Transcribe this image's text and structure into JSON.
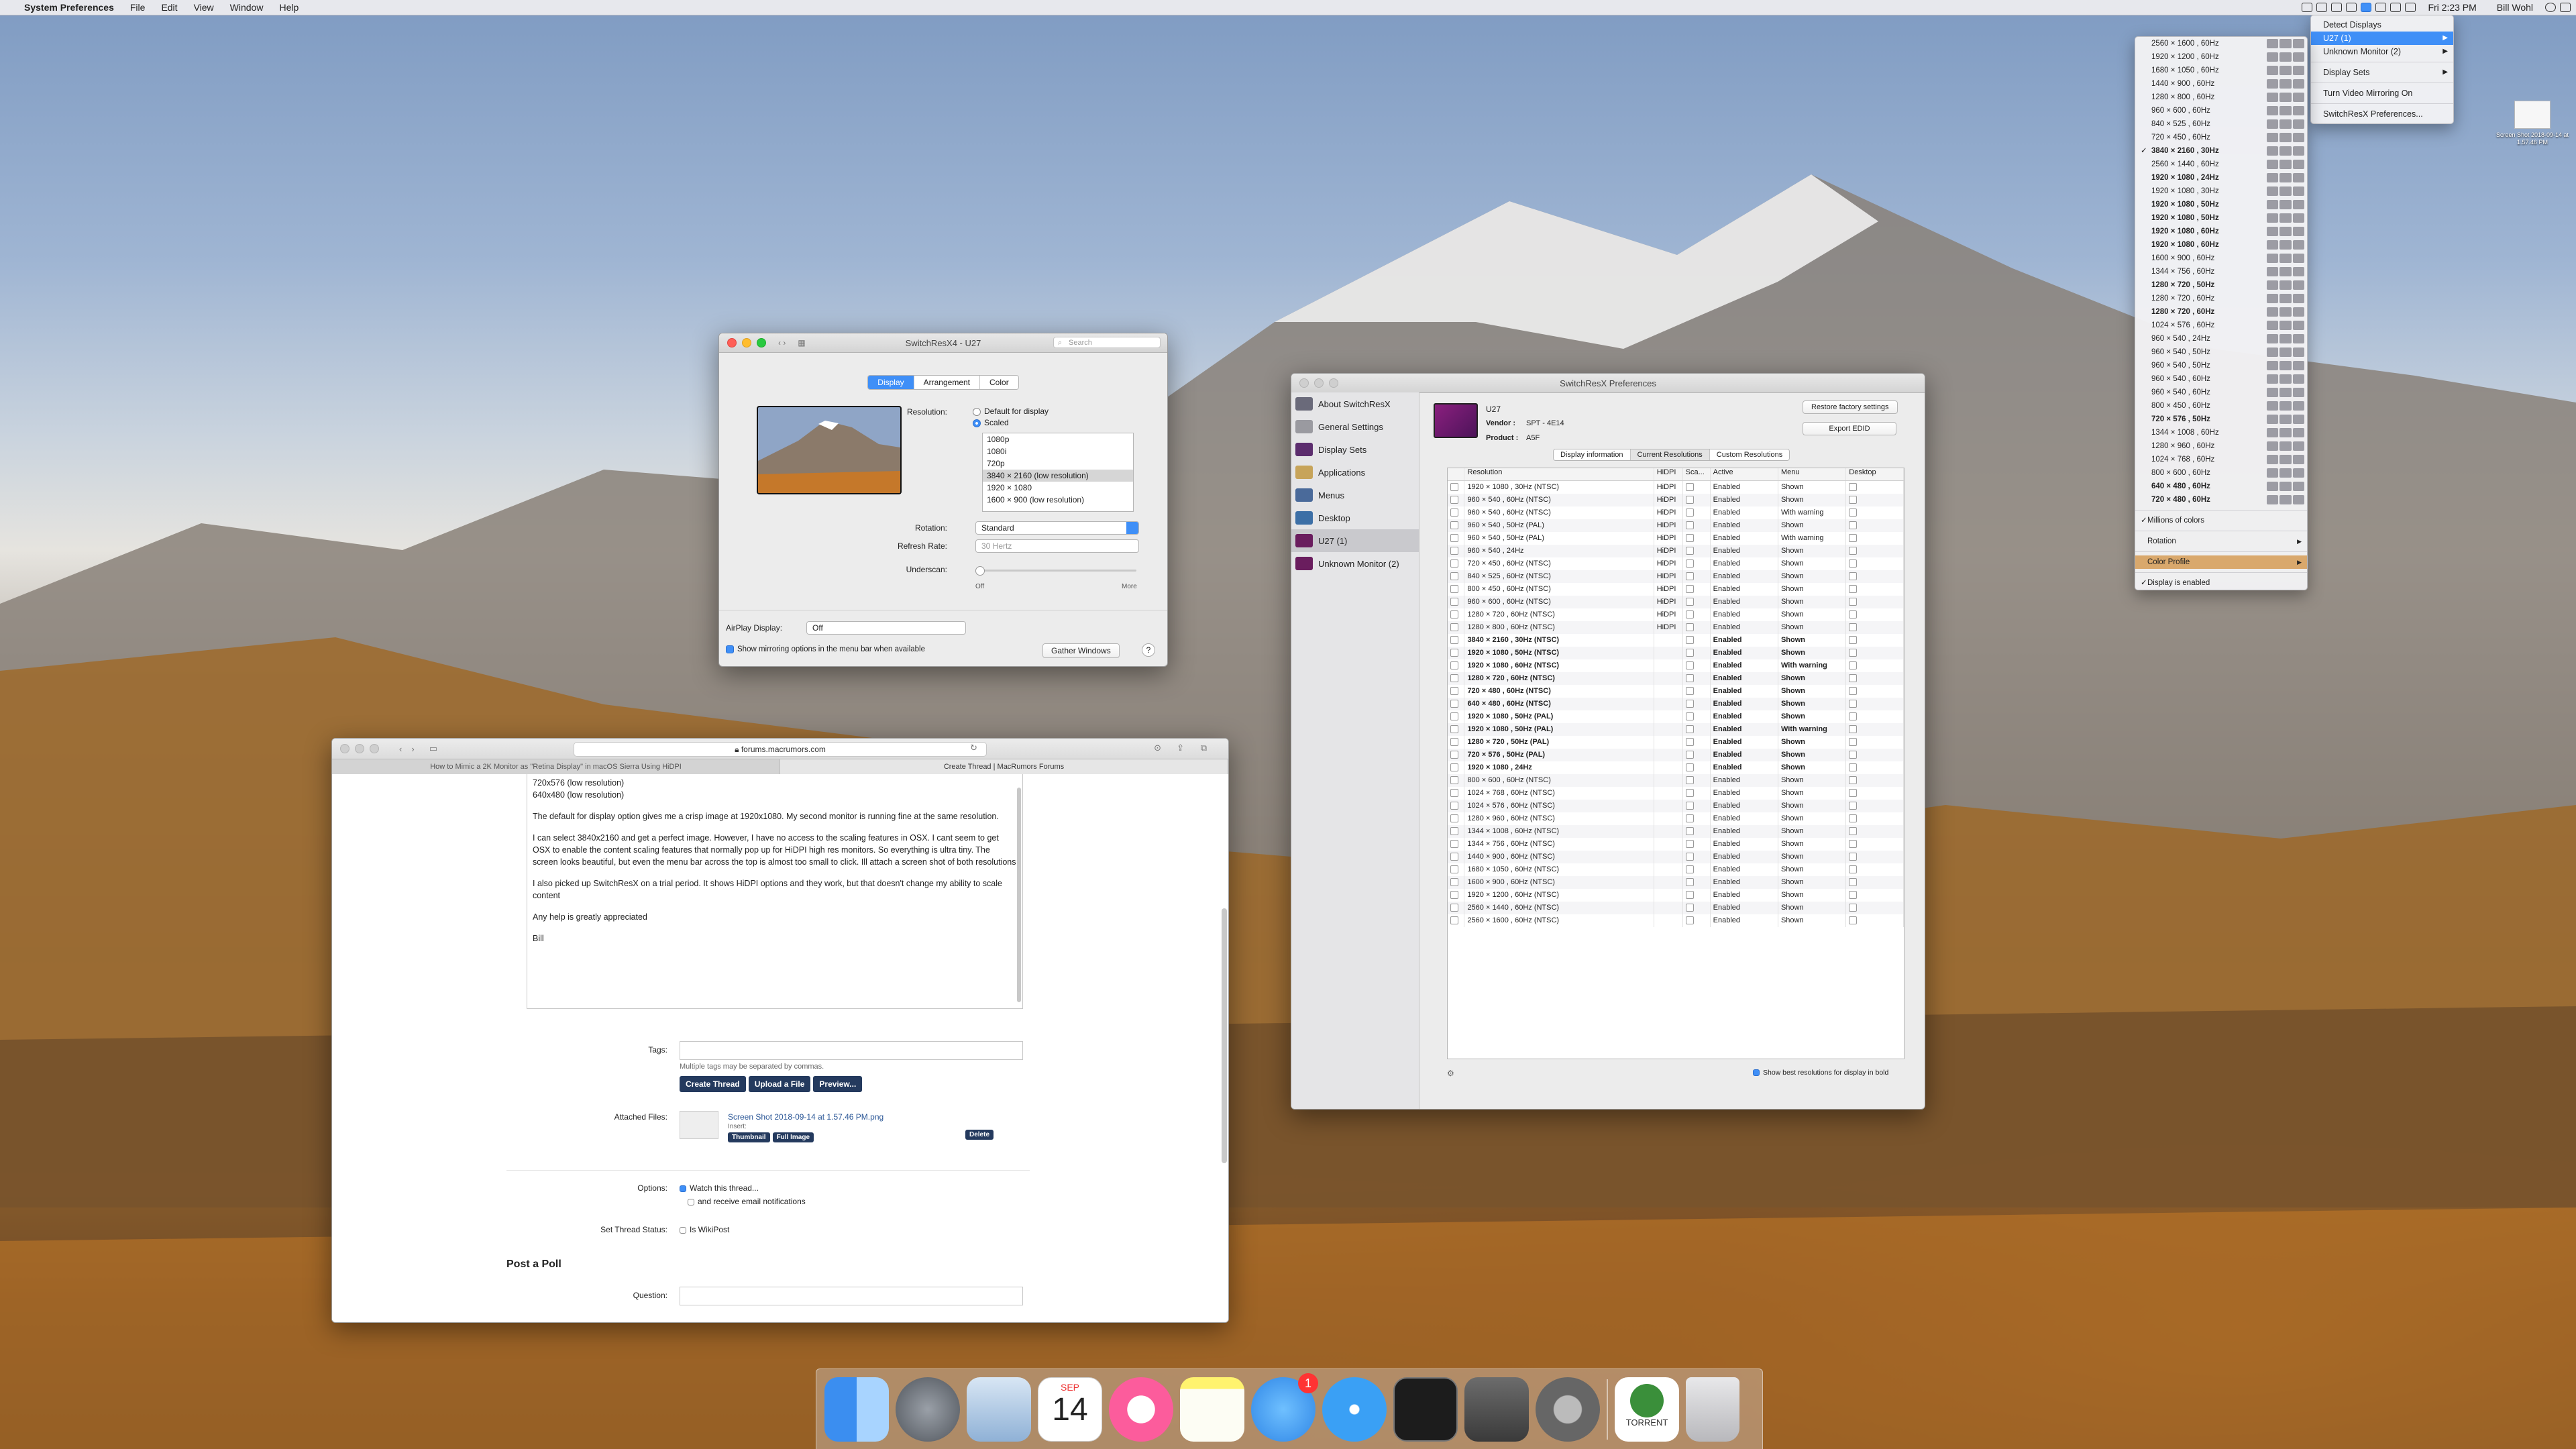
{
  "menubar": {
    "app_name": "System Preferences",
    "items": [
      "File",
      "Edit",
      "View",
      "Window",
      "Help"
    ],
    "clock": "Fri 2:23 PM",
    "user": "Bill Wohl"
  },
  "display_window": {
    "title": "SwitchResX4 - U27",
    "search_placeholder": "Search",
    "tabs": [
      "Display",
      "Arrangement",
      "Color"
    ],
    "resolution_label": "Resolution:",
    "default_option": "Default for display",
    "scaled_option": "Scaled",
    "resolutions": [
      "1080p",
      "1080i",
      "720p",
      "3840 × 2160 (low resolution)",
      "1920 × 1080",
      "1600 × 900 (low resolution)"
    ],
    "selected_resolution": "3840 × 2160 (low resolution)",
    "rotation_label": "Rotation:",
    "rotation_value": "Standard",
    "refresh_label": "Refresh Rate:",
    "refresh_value": "30 Hertz",
    "underscan_label": "Underscan:",
    "underscan_min": "Off",
    "underscan_max": "More",
    "airplay_label": "AirPlay Display:",
    "airplay_value": "Off",
    "mirroring_checkbox": "Show mirroring options in the menu bar when available",
    "gather_button": "Gather Windows",
    "help": "?"
  },
  "srx_prefs": {
    "title": "SwitchResX Preferences",
    "sidebar": [
      "About SwitchResX",
      "General Settings",
      "Display Sets",
      "Applications",
      "Menus",
      "Desktop",
      "U27 (1)",
      "Unknown Monitor (2)"
    ],
    "monitor_name": "U27",
    "vendor_label": "Vendor :",
    "vendor_value": "SPT - 4E14",
    "product_label": "Product :",
    "product_value": "A5F",
    "restore_button": "Restore factory settings",
    "export_button": "Export EDID",
    "tabs": [
      "Display information",
      "Current Resolutions",
      "Custom Resolutions"
    ],
    "columns": [
      "Resolution",
      "HiDPI",
      "Sca...",
      "Active",
      "Menu",
      "Desktop"
    ],
    "rows": [
      {
        "res": "1920 × 1080 , 30Hz (NTSC)",
        "hidpi": "HiDPI",
        "active": "Enabled",
        "menu": "Shown",
        "bold": false
      },
      {
        "res": "960 × 540 , 60Hz (NTSC)",
        "hidpi": "HiDPI",
        "active": "Enabled",
        "menu": "Shown",
        "bold": false
      },
      {
        "res": "960 × 540 , 60Hz (NTSC)",
        "hidpi": "HiDPI",
        "active": "Enabled",
        "menu": "With warning",
        "bold": false
      },
      {
        "res": "960 × 540 , 50Hz (PAL)",
        "hidpi": "HiDPI",
        "active": "Enabled",
        "menu": "Shown",
        "bold": false
      },
      {
        "res": "960 × 540 , 50Hz (PAL)",
        "hidpi": "HiDPI",
        "active": "Enabled",
        "menu": "With warning",
        "bold": false
      },
      {
        "res": "960 × 540 , 24Hz",
        "hidpi": "HiDPI",
        "active": "Enabled",
        "menu": "Shown",
        "bold": false
      },
      {
        "res": "720 × 450 , 60Hz (NTSC)",
        "hidpi": "HiDPI",
        "active": "Enabled",
        "menu": "Shown",
        "bold": false
      },
      {
        "res": "840 × 525 , 60Hz (NTSC)",
        "hidpi": "HiDPI",
        "active": "Enabled",
        "menu": "Shown",
        "bold": false
      },
      {
        "res": "800 × 450 , 60Hz (NTSC)",
        "hidpi": "HiDPI",
        "active": "Enabled",
        "menu": "Shown",
        "bold": false
      },
      {
        "res": "960 × 600 , 60Hz (NTSC)",
        "hidpi": "HiDPI",
        "active": "Enabled",
        "menu": "Shown",
        "bold": false
      },
      {
        "res": "1280 × 720 , 60Hz (NTSC)",
        "hidpi": "HiDPI",
        "active": "Enabled",
        "menu": "Shown",
        "bold": false
      },
      {
        "res": "1280 × 800 , 60Hz (NTSC)",
        "hidpi": "HiDPI",
        "active": "Enabled",
        "menu": "Shown",
        "bold": false
      },
      {
        "res": "3840 × 2160 , 30Hz (NTSC)",
        "hidpi": "",
        "active": "Enabled",
        "menu": "Shown",
        "bold": true
      },
      {
        "res": "1920 × 1080 , 50Hz (NTSC)",
        "hidpi": "",
        "active": "Enabled",
        "menu": "Shown",
        "bold": true
      },
      {
        "res": "1920 × 1080 , 60Hz (NTSC)",
        "hidpi": "",
        "active": "Enabled",
        "menu": "With warning",
        "bold": true
      },
      {
        "res": "1280 × 720 , 60Hz (NTSC)",
        "hidpi": "",
        "active": "Enabled",
        "menu": "Shown",
        "bold": true
      },
      {
        "res": "720 × 480 , 60Hz (NTSC)",
        "hidpi": "",
        "active": "Enabled",
        "menu": "Shown",
        "bold": true
      },
      {
        "res": "640 × 480 , 60Hz (NTSC)",
        "hidpi": "",
        "active": "Enabled",
        "menu": "Shown",
        "bold": true
      },
      {
        "res": "1920 × 1080 , 50Hz (PAL)",
        "hidpi": "",
        "active": "Enabled",
        "menu": "Shown",
        "bold": true
      },
      {
        "res": "1920 × 1080 , 50Hz (PAL)",
        "hidpi": "",
        "active": "Enabled",
        "menu": "With warning",
        "bold": true
      },
      {
        "res": "1280 × 720 , 50Hz (PAL)",
        "hidpi": "",
        "active": "Enabled",
        "menu": "Shown",
        "bold": true
      },
      {
        "res": "720 × 576 , 50Hz (PAL)",
        "hidpi": "",
        "active": "Enabled",
        "menu": "Shown",
        "bold": true
      },
      {
        "res": "1920 × 1080 , 24Hz",
        "hidpi": "",
        "active": "Enabled",
        "menu": "Shown",
        "bold": true
      },
      {
        "res": "800 × 600 , 60Hz (NTSC)",
        "hidpi": "",
        "active": "Enabled",
        "menu": "Shown",
        "bold": false
      },
      {
        "res": "1024 × 768 , 60Hz (NTSC)",
        "hidpi": "",
        "active": "Enabled",
        "menu": "Shown",
        "bold": false
      },
      {
        "res": "1024 × 576 , 60Hz (NTSC)",
        "hidpi": "",
        "active": "Enabled",
        "menu": "Shown",
        "bold": false
      },
      {
        "res": "1280 × 960 , 60Hz (NTSC)",
        "hidpi": "",
        "active": "Enabled",
        "menu": "Shown",
        "bold": false
      },
      {
        "res": "1344 × 1008 , 60Hz (NTSC)",
        "hidpi": "",
        "active": "Enabled",
        "menu": "Shown",
        "bold": false
      },
      {
        "res": "1344 × 756 , 60Hz (NTSC)",
        "hidpi": "",
        "active": "Enabled",
        "menu": "Shown",
        "bold": false
      },
      {
        "res": "1440 × 900 , 60Hz (NTSC)",
        "hidpi": "",
        "active": "Enabled",
        "menu": "Shown",
        "bold": false
      },
      {
        "res": "1680 × 1050 , 60Hz (NTSC)",
        "hidpi": "",
        "active": "Enabled",
        "menu": "Shown",
        "bold": false
      },
      {
        "res": "1600 × 900 , 60Hz (NTSC)",
        "hidpi": "",
        "active": "Enabled",
        "menu": "Shown",
        "bold": false
      },
      {
        "res": "1920 × 1200 , 60Hz (NTSC)",
        "hidpi": "",
        "active": "Enabled",
        "menu": "Shown",
        "bold": false
      },
      {
        "res": "2560 × 1440 , 60Hz (NTSC)",
        "hidpi": "",
        "active": "Enabled",
        "menu": "Shown",
        "bold": false
      },
      {
        "res": "2560 × 1600 , 60Hz (NTSC)",
        "hidpi": "",
        "active": "Enabled",
        "menu": "Shown",
        "bold": false
      }
    ],
    "footer_checkbox": "Show best resolutions for display in bold"
  },
  "browser": {
    "url": "forums.macrumors.com",
    "tabs": [
      "How to Mimic a 2K Monitor as \"Retina Display\" in macOS Sierra Using HiDPI",
      "Create Thread | MacRumors Forums"
    ],
    "message_lines": [
      "720x576 (low resolution)",
      "640x480 (low resolution)"
    ],
    "message_paragraphs": [
      "The default for display option gives me a crisp image at 1920x1080. My second monitor is running fine at the same resolution.",
      "I can select 3840x2160 and get a perfect image. However, I have no access to the scaling features in OSX. I cant seem to get OSX to enable the content scaling features that normally pop up for HiDPI high res monitors. So everything is ultra tiny. The screen looks beautiful, but even the menu bar across the top is almost too small to click. Ill attach a screen shot of both resolutions",
      "I also picked up SwitchResX on a trial period. It shows HiDPI options and they work, but that doesn't change my ability to scale content",
      "Any help is greatly appreciated",
      "Bill"
    ],
    "tags_label": "Tags:",
    "tags_hint": "Multiple tags may be separated by commas.",
    "create_thread": "Create Thread",
    "upload_file": "Upload a File",
    "preview": "Preview...",
    "attached_label": "Attached Files:",
    "attachment_name": "Screen Shot 2018-09-14 at 1.57.46 PM.png",
    "insert_label": "Insert:",
    "thumbnail_btn": "Thumbnail",
    "fullimage_btn": "Full Image",
    "delete_btn": "Delete",
    "options_label": "Options:",
    "watch_option": "Watch this thread...",
    "email_option": "and receive email notifications",
    "status_label": "Set Thread Status:",
    "wikipost_option": "Is WikiPost",
    "poll_heading": "Post a Poll",
    "question_label": "Question:"
  },
  "display_menu": {
    "items": [
      "Detect Displays",
      "U27 (1)",
      "Unknown Monitor (2)",
      "Display Sets",
      "Turn Video Mirroring On",
      "SwitchResX Preferences..."
    ]
  },
  "resolution_menu": {
    "items": [
      {
        "label": "2560 × 1600 , 60Hz",
        "bold": false,
        "check": false
      },
      {
        "label": "1920 × 1200 , 60Hz",
        "bold": false,
        "check": false
      },
      {
        "label": "1680 × 1050 , 60Hz",
        "bold": false,
        "check": false
      },
      {
        "label": "1440 × 900 , 60Hz",
        "bold": false,
        "check": false
      },
      {
        "label": "1280 × 800 , 60Hz",
        "bold": false,
        "check": false
      },
      {
        "label": "960 × 600 , 60Hz",
        "bold": false,
        "check": false
      },
      {
        "label": "840 × 525 , 60Hz",
        "bold": false,
        "check": false
      },
      {
        "label": "720 × 450 , 60Hz",
        "bold": false,
        "check": false
      },
      {
        "label": "3840 × 2160 , 30Hz",
        "bold": true,
        "check": true
      },
      {
        "label": "2560 × 1440 , 60Hz",
        "bold": false,
        "check": false
      },
      {
        "label": "1920 × 1080 , 24Hz",
        "bold": true,
        "check": false
      },
      {
        "label": "1920 × 1080 , 30Hz",
        "bold": false,
        "check": false
      },
      {
        "label": "1920 × 1080 , 50Hz",
        "bold": true,
        "check": false
      },
      {
        "label": "1920 × 1080 , 50Hz",
        "bold": true,
        "check": false
      },
      {
        "label": "1920 × 1080 , 60Hz",
        "bold": true,
        "check": false
      },
      {
        "label": "1920 × 1080 , 60Hz",
        "bold": true,
        "check": false
      },
      {
        "label": "1600 × 900 , 60Hz",
        "bold": false,
        "check": false
      },
      {
        "label": "1344 × 756 , 60Hz",
        "bold": false,
        "check": false
      },
      {
        "label": "1280 × 720 , 50Hz",
        "bold": true,
        "check": false
      },
      {
        "label": "1280 × 720 , 60Hz",
        "bold": false,
        "check": false
      },
      {
        "label": "1280 × 720 , 60Hz",
        "bold": true,
        "check": false
      },
      {
        "label": "1024 × 576 , 60Hz",
        "bold": false,
        "check": false
      },
      {
        "label": "960 × 540 , 24Hz",
        "bold": false,
        "check": false
      },
      {
        "label": "960 × 540 , 50Hz",
        "bold": false,
        "check": false
      },
      {
        "label": "960 × 540 , 50Hz",
        "bold": false,
        "check": false
      },
      {
        "label": "960 × 540 , 60Hz",
        "bold": false,
        "check": false
      },
      {
        "label": "960 × 540 , 60Hz",
        "bold": false,
        "check": false
      },
      {
        "label": "800 × 450 , 60Hz",
        "bold": false,
        "check": false
      },
      {
        "label": "720 × 576 , 50Hz",
        "bold": true,
        "check": false
      },
      {
        "label": "1344 × 1008 , 60Hz",
        "bold": false,
        "check": false
      },
      {
        "label": "1280 × 960 , 60Hz",
        "bold": false,
        "check": false
      },
      {
        "label": "1024 × 768 , 60Hz",
        "bold": false,
        "check": false
      },
      {
        "label": "800 × 600 , 60Hz",
        "bold": false,
        "check": false
      },
      {
        "label": "640 × 480 , 60Hz",
        "bold": true,
        "check": false
      },
      {
        "label": "720 × 480 , 60Hz",
        "bold": true,
        "check": false
      }
    ],
    "footer": [
      "Millions of colors",
      "Rotation",
      "Color Profile",
      "Display is enabled"
    ]
  },
  "desktop_file": {
    "label": "Screen Shot 2018-09-14 at 1.57.46 PM"
  },
  "dock": {
    "calendar_month": "SEP",
    "calendar_day": "14",
    "messages_badge": "1",
    "torrent_label": "TORRENT"
  },
  "colors": {
    "accent": "#3f8ff7",
    "forum_button": "#243a5e"
  }
}
